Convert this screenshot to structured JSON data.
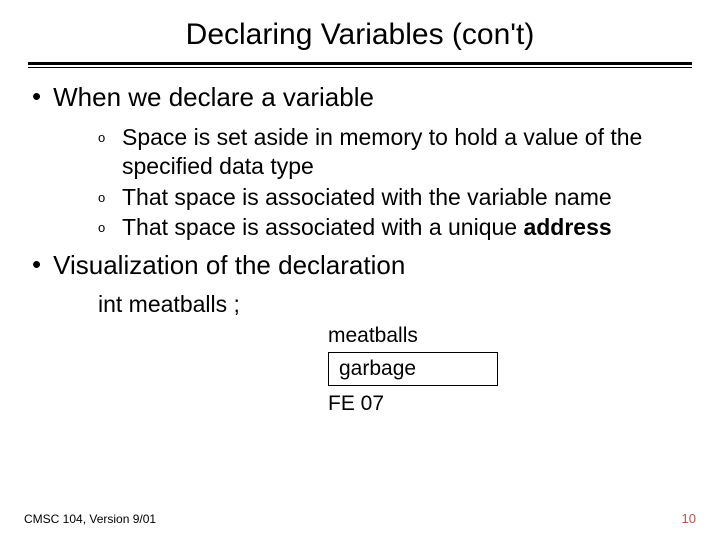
{
  "title": "Declaring Variables (con't)",
  "bullets": {
    "b1": "When we declare a variable",
    "s1": "Space is set aside in memory to hold a value of the specified data type",
    "s2": "That space is associated with the variable name",
    "s3_prefix": "That space is associated with a unique ",
    "s3_bold": "address",
    "b2": "Visualization of the declaration"
  },
  "code": "int  meatballs ;",
  "viz": {
    "label": "meatballs",
    "box": "garbage",
    "addr": "FE 07"
  },
  "footer": {
    "left": "CMSC 104, Version 9/01",
    "right": "10"
  },
  "markers": {
    "dot": "•",
    "o": "o"
  }
}
